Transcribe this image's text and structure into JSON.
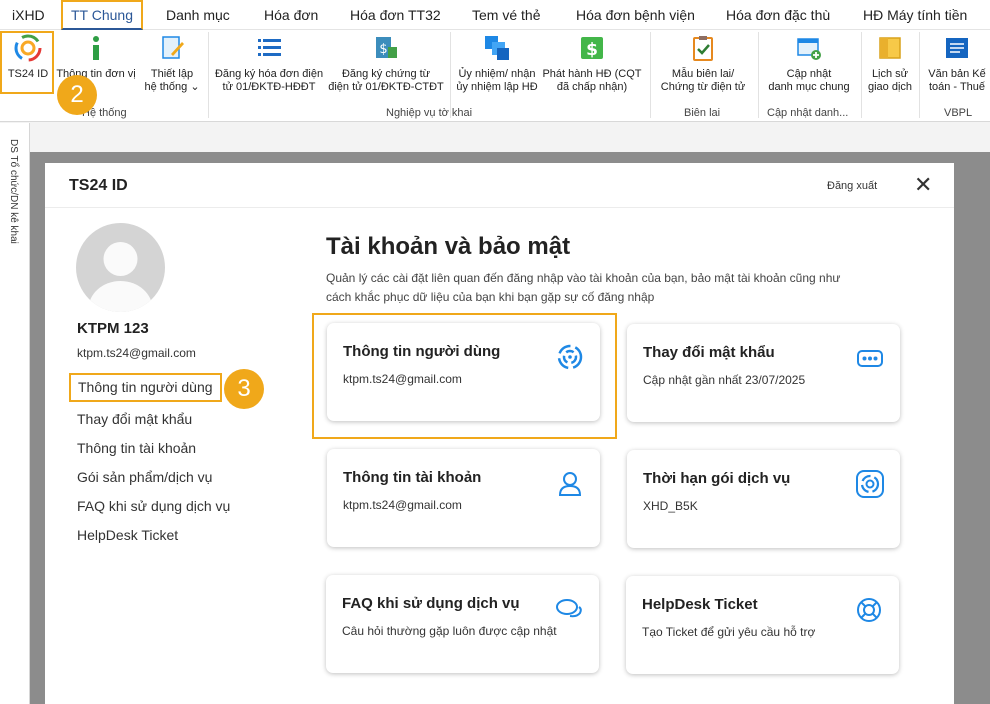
{
  "menu": {
    "tabs": [
      "iXHD",
      "TT Chung",
      "Danh mục",
      "Hóa đơn",
      "Hóa đơn TT32",
      "Tem vé thẻ",
      "Hóa đơn bệnh viện",
      "Hóa đơn đặc thù",
      "HĐ Máy tính tiền"
    ]
  },
  "ribbon": {
    "buttons": [
      {
        "l1": "TS24 ID",
        "l2": ""
      },
      {
        "l1": "Thông tin đơn vị",
        "l2": ""
      },
      {
        "l1": "Thiết lập",
        "l2": "hệ thống ⌄"
      },
      {
        "l1": "Đăng ký hóa đơn điện",
        "l2": "tử 01/ĐKTĐ-HĐĐT"
      },
      {
        "l1": "Đăng ký chứng từ",
        "l2": "điện tử 01/ĐKTĐ-CTĐT"
      },
      {
        "l1": "Ủy nhiệm/ nhận",
        "l2": "ủy nhiệm lập HĐ"
      },
      {
        "l1": "Phát hành HĐ (CQT",
        "l2": "đã chấp nhận)"
      },
      {
        "l1": "Mẫu biên lai/",
        "l2": "Chứng từ điện tử"
      },
      {
        "l1": "Cập nhật",
        "l2": "danh mục chung"
      },
      {
        "l1": "Lịch sử",
        "l2": "giao dịch"
      },
      {
        "l1": "Văn bản Kế",
        "l2": "toán - Thuế"
      }
    ],
    "groups": [
      "Hệ thống",
      "Nghiệp vụ tờ khai",
      "Biên lai",
      "Cập nhật danh...",
      "VBPL"
    ]
  },
  "badges": {
    "b2": "2",
    "b3": "3"
  },
  "side_panel": {
    "label": "DS Tổ chức/DN kê khai"
  },
  "dialog": {
    "title": "TS24 ID",
    "logout": "Đăng xuất",
    "close": "✕",
    "user": {
      "name": "KTPM 123",
      "email": "ktpm.ts24@gmail.com"
    },
    "nav": [
      "Thông tin người dùng",
      "Thay đổi mật khẩu",
      "Thông tin tài khoản",
      "Gói sản phẩm/dịch vụ",
      "FAQ khi sử dụng dịch vụ",
      "HelpDesk Ticket"
    ],
    "heading": "Tài khoản và bảo mật",
    "description": "Quản lý các cài đặt liên quan đến đăng nhập vào tài khoản của bạn, bảo mật tài khoản cũng như cách khắc phục dữ liệu của bạn khi bạn gặp sự cố đăng nhập",
    "cards": [
      {
        "title": "Thông tin người dùng",
        "sub": "ktpm.ts24@gmail.com",
        "icon": "swirl-logo-icon"
      },
      {
        "title": "Thay đổi mật khẩu",
        "sub": "Cập nhật gần nhất 23/07/2025",
        "icon": "password-dots-icon"
      },
      {
        "title": "Thông tin tài khoản",
        "sub": "ktpm.ts24@gmail.com",
        "icon": "user-icon"
      },
      {
        "title": "Thời hạn gói dịch vụ",
        "sub": "XHD_B5K",
        "icon": "swirl-badge-icon"
      },
      {
        "title": "FAQ khi sử dụng dịch vụ",
        "sub": "Câu hỏi thường gặp luôn được cập nhật",
        "icon": "chat-bubbles-icon"
      },
      {
        "title": "HelpDesk Ticket",
        "sub": "Tạo Ticket để gửi yêu cầu hỗ trợ",
        "icon": "lifebuoy-icon"
      }
    ]
  },
  "colors": {
    "accent": "#f0a81a",
    "primary": "#2b5797",
    "icon_blue": "#1e88e5"
  }
}
